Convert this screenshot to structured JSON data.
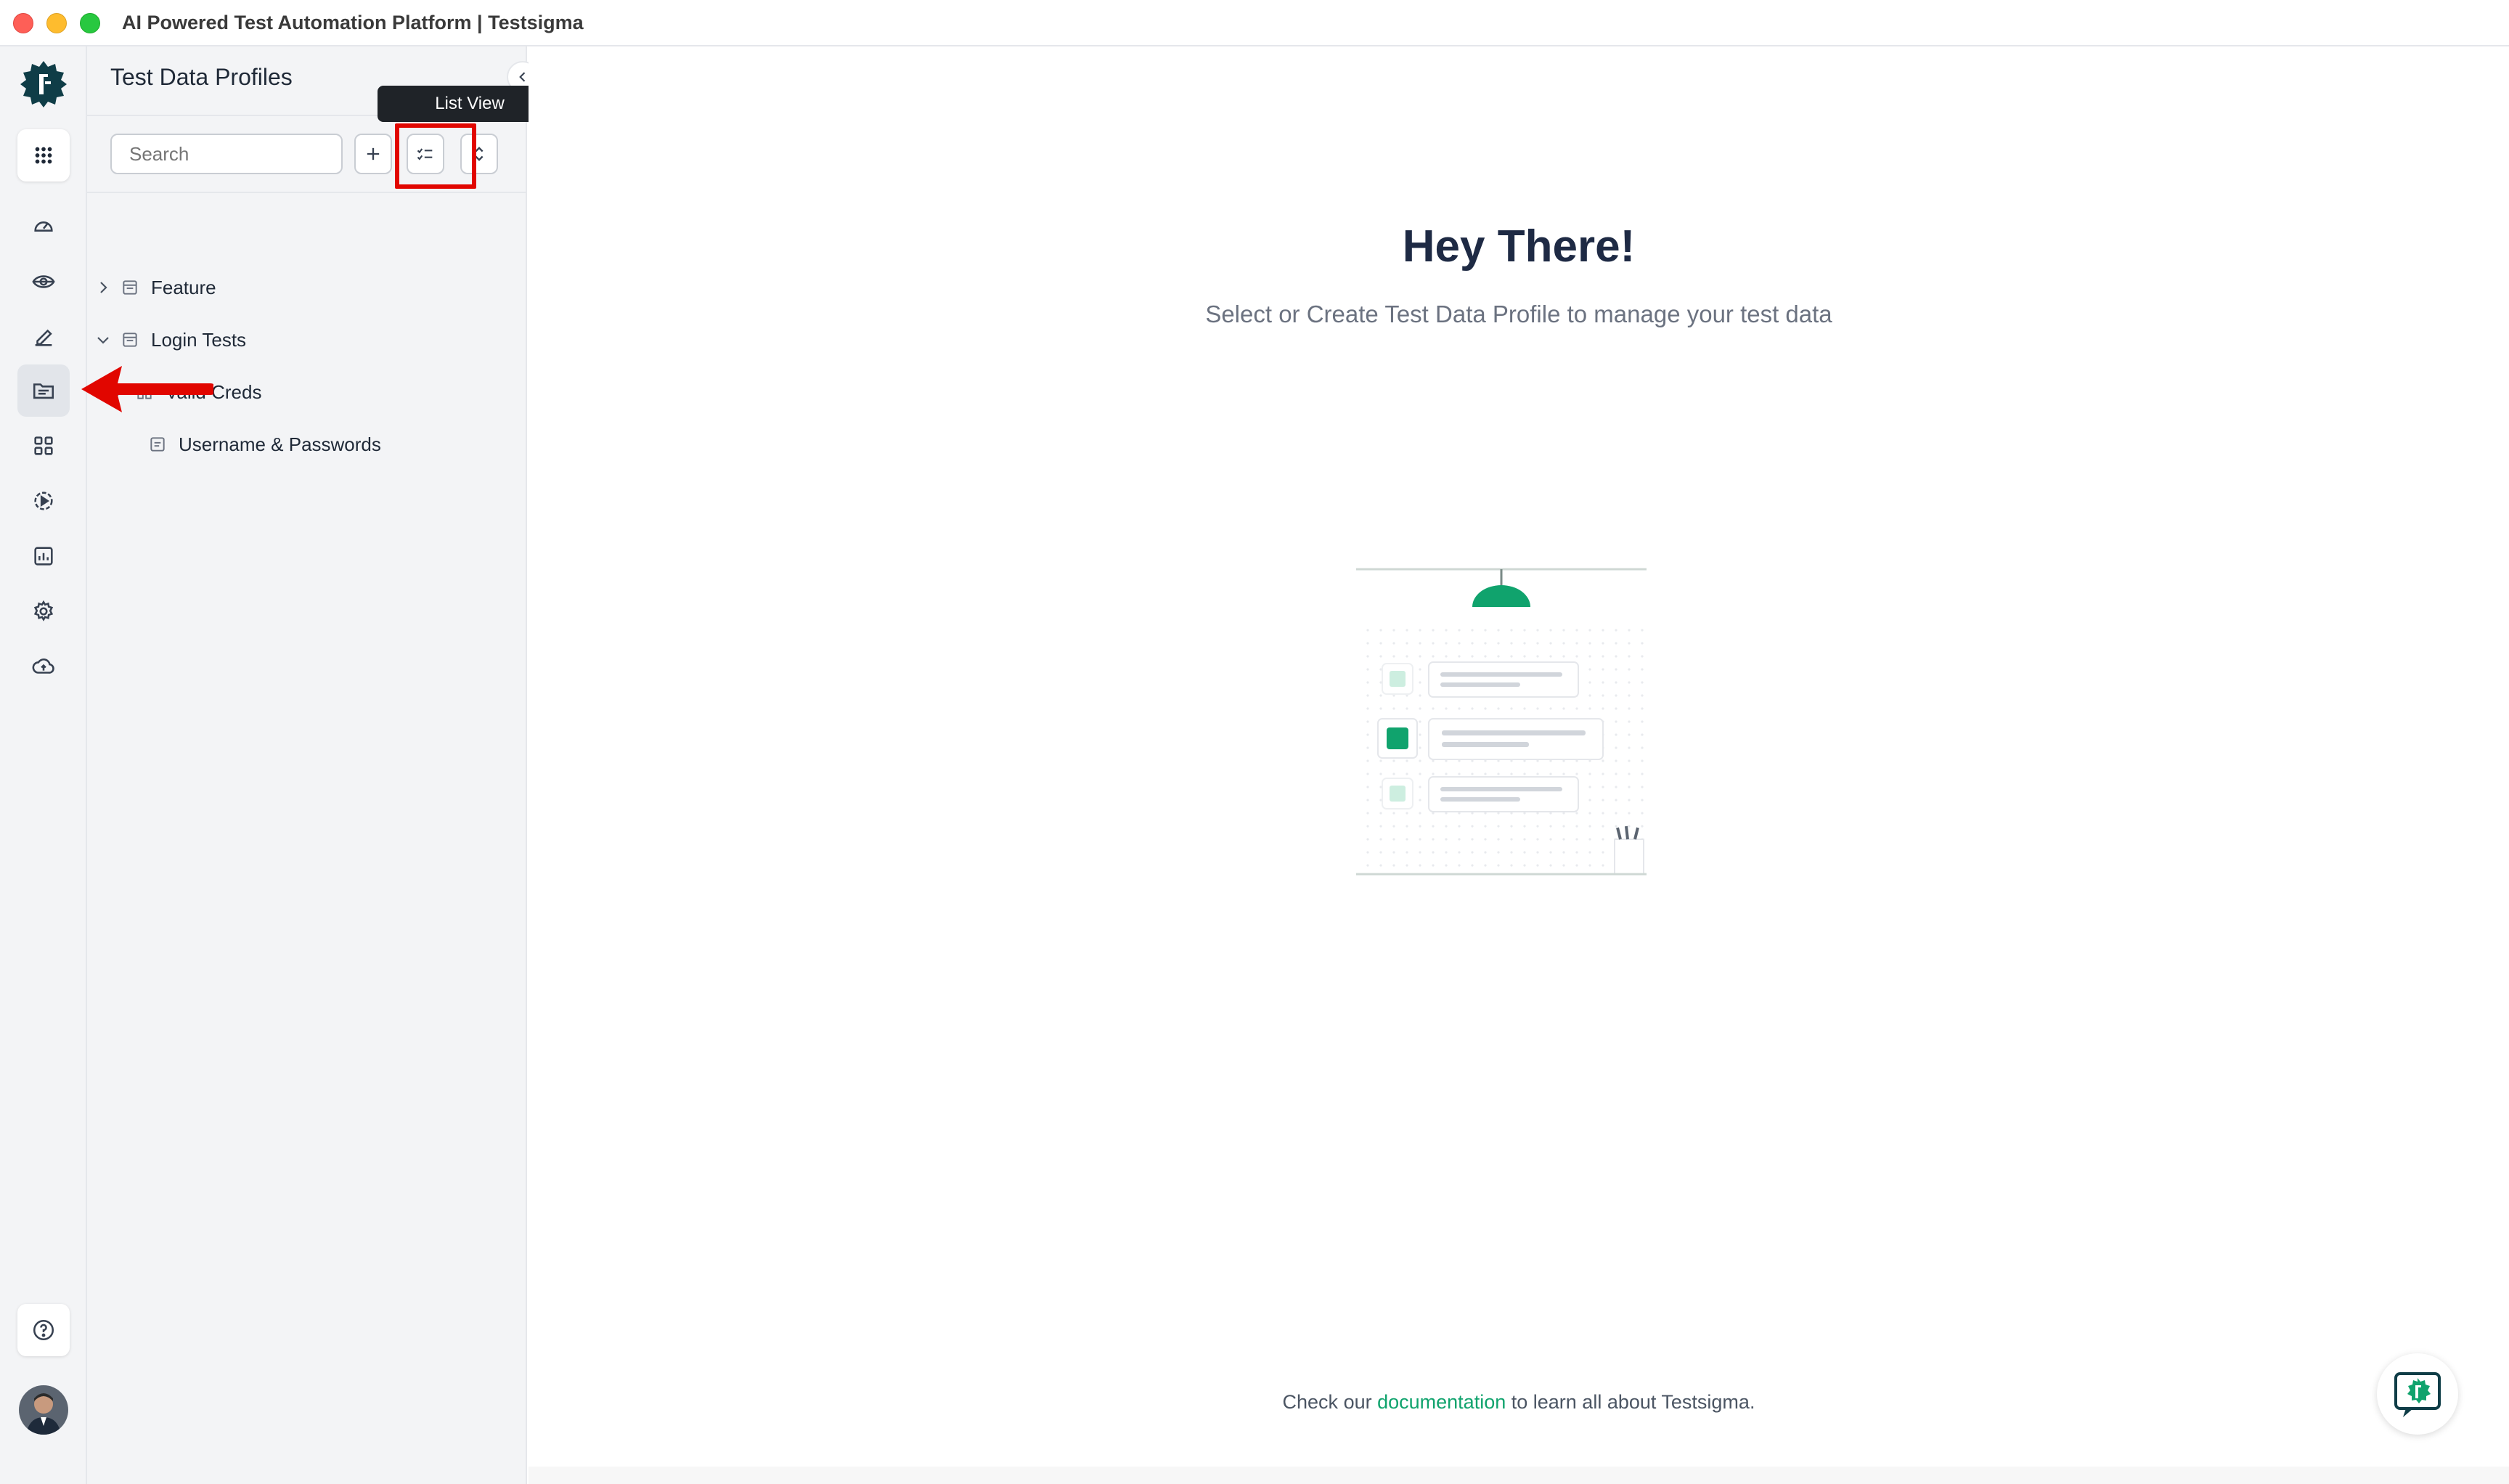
{
  "window": {
    "title": "AI Powered Test Automation Platform | Testsigma"
  },
  "rail": {
    "items": [
      {
        "name": "apps-grid-icon"
      },
      {
        "name": "dashboard-icon"
      },
      {
        "name": "eye-icon"
      },
      {
        "name": "edit-pen-icon"
      },
      {
        "name": "folder-icon",
        "active": true
      },
      {
        "name": "blocks-icon"
      },
      {
        "name": "run-icon"
      },
      {
        "name": "reports-icon"
      },
      {
        "name": "settings-icon"
      },
      {
        "name": "cloud-upload-icon"
      },
      {
        "name": "help-icon"
      }
    ]
  },
  "panel": {
    "title": "Test Data Profiles",
    "search_placeholder": "Search",
    "tooltip": "List View",
    "tree": [
      {
        "label": "Feature",
        "expanded": false,
        "level": 0
      },
      {
        "label": "Login Tests",
        "expanded": true,
        "level": 0
      },
      {
        "label": "Valid Creds",
        "expanded": true,
        "level": 1
      },
      {
        "label": "Username & Passwords",
        "level": 2
      }
    ]
  },
  "main": {
    "heading": "Hey There!",
    "subheading": "Select or Create Test Data Profile to manage your test data",
    "footer_prefix": "Check our",
    "footer_link": "documentation",
    "footer_suffix": "to learn all about Testsigma."
  },
  "colors": {
    "accent": "#10a36d",
    "brand_dark": "#0f3d47",
    "highlight_red": "#e10600"
  }
}
